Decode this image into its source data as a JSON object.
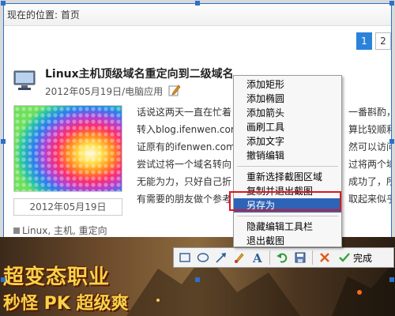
{
  "breadcrumb": {
    "label": "现在的位置: 首页"
  },
  "pager": {
    "pages": [
      "1",
      "2"
    ],
    "active": "1"
  },
  "article": {
    "title": "Linux主机顶级域名重定向到二级域名",
    "date_category": "2012年05月19日/电脑应用",
    "thumb_date": "2012年05月19日",
    "tags": "Linux, 主机, 重定向",
    "body_lines": [
      "话说这两天一直在忙着",
      "转入blog.ifenwen.com",
      "证原有的ifenwen.com",
      "尝试过将一个域名转向",
      "无能为力，只好自己折",
      "有需要的朋友做个参考"
    ],
    "body_right": [
      "一番斟酌，准",
      "算比较顺利",
      "然可以访问,",
      "过将两个域名",
      "成功了，所以",
      "取起来似乎不"
    ]
  },
  "context_menu": {
    "items": [
      {
        "label": "添加矩形"
      },
      {
        "label": "添加椭圆"
      },
      {
        "label": "添加箭头"
      },
      {
        "label": "画刷工具"
      },
      {
        "label": "添加文字"
      },
      {
        "label": "撤销编辑"
      },
      {
        "label": "重新选择截图区域"
      },
      {
        "label": "复制并退出截图"
      },
      {
        "label": "另存为"
      },
      {
        "label": "隐藏编辑工具栏"
      },
      {
        "label": "退出截图"
      }
    ]
  },
  "banner": {
    "line1": "超变态职业",
    "line2": "秒怪 PK 超级爽"
  },
  "toolbar": {
    "icons": [
      "rectangle-icon",
      "ellipse-icon",
      "arrow-icon",
      "brush-icon",
      "text-icon",
      "undo-icon",
      "save-icon",
      "cancel-icon",
      "done-icon"
    ],
    "done_label": "完成"
  },
  "colors": {
    "accent": "#2b82d9",
    "selection": "#2d64b8",
    "highlight_box": "#e0141e"
  }
}
